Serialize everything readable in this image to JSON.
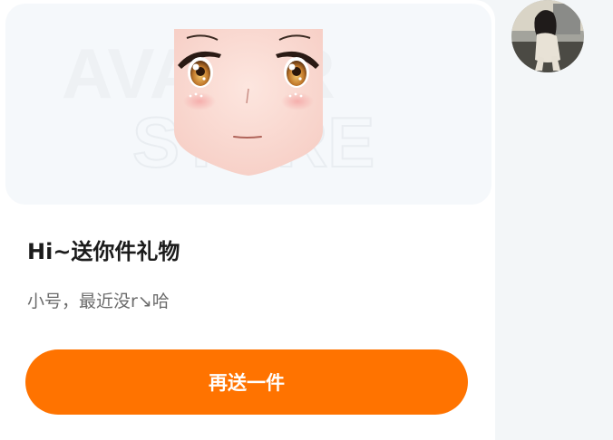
{
  "message": {
    "title": "Hi~送你件礼物",
    "subtitle": "小号，最近没r↘哈",
    "button_label": "再送一件"
  },
  "watermark": {
    "line1": "AVATAR",
    "line2": "STORE"
  },
  "colors": {
    "accent": "#ff7300",
    "title": "#1b1b1b",
    "subtitle": "#6b6b6b",
    "preview_bg": "#f5f8fb",
    "page_bg": "#f3f6f8"
  },
  "icons": {
    "gift_preview": "avatar-face-icon",
    "sender": "avatar"
  }
}
